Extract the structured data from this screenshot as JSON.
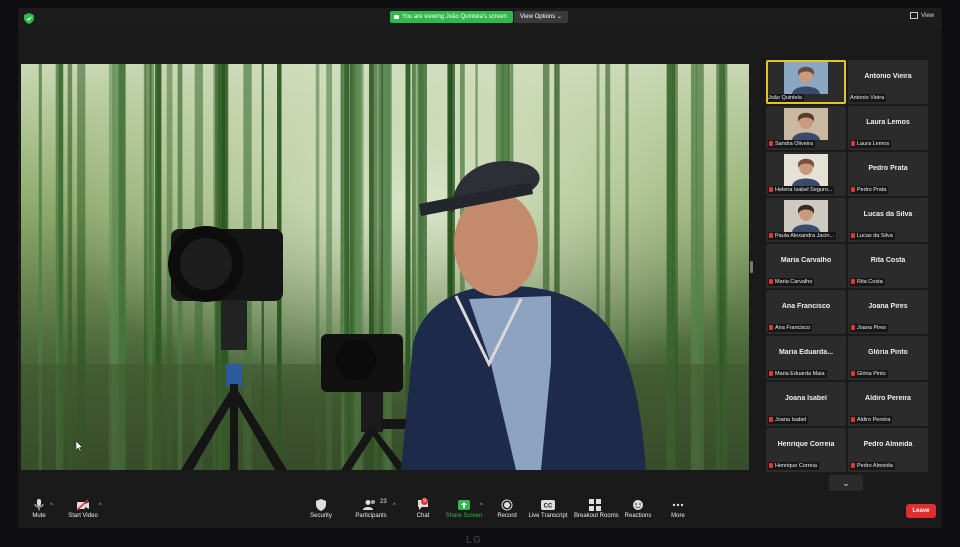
{
  "top_bar": {
    "viewing_banner": "You are viewing João Quintela's screen",
    "view_options_label": "View Options",
    "view_label": "View"
  },
  "gallery": {
    "tiles": [
      {
        "big_name": "",
        "label": "João Quintela",
        "has_video": true,
        "muted": false,
        "active": true
      },
      {
        "big_name": "Antonio Vieira",
        "label": "Antonio Vieira",
        "has_video": false,
        "muted": false
      },
      {
        "big_name": "",
        "label": "Sandra Oliveira",
        "has_video": true,
        "muted": true
      },
      {
        "big_name": "Laura Lemos",
        "label": "Laura Lemos",
        "has_video": false,
        "muted": true
      },
      {
        "big_name": "",
        "label": "Helena Isabel Seguro...",
        "has_video": true,
        "muted": true
      },
      {
        "big_name": "Pedro Prata",
        "label": "Pedro Prata",
        "has_video": false,
        "muted": true
      },
      {
        "big_name": "",
        "label": "Paula Alexandra Jacin...",
        "has_video": true,
        "muted": true
      },
      {
        "big_name": "Lucas da Silva",
        "label": "Lucas da Silva",
        "has_video": false,
        "muted": true
      },
      {
        "big_name": "Maria Carvalho",
        "label": "Maria Carvalho",
        "has_video": false,
        "muted": true
      },
      {
        "big_name": "Rita Costa",
        "label": "Rita Costa",
        "has_video": false,
        "muted": true
      },
      {
        "big_name": "Ana Francisco",
        "label": "Ana Francisco",
        "has_video": false,
        "muted": true
      },
      {
        "big_name": "Joana Pires",
        "label": "Joana Pires",
        "has_video": false,
        "muted": true
      },
      {
        "big_name": "Maria Eduarda...",
        "label": "Maria Eduarda Maia",
        "has_video": false,
        "muted": true
      },
      {
        "big_name": "Glória Pinto",
        "label": "Glória Pinto",
        "has_video": false,
        "muted": true
      },
      {
        "big_name": "Joana Isabel",
        "label": "Joana Isabel",
        "has_video": false,
        "muted": true
      },
      {
        "big_name": "Aldiro Pereira",
        "label": "Aldiro Pereira",
        "has_video": false,
        "muted": true
      },
      {
        "big_name": "Henrique Correia",
        "label": "Henrique Correia",
        "has_video": false,
        "muted": true
      },
      {
        "big_name": "Pedro Almeida",
        "label": "Pedro Almeida",
        "has_video": false,
        "muted": true
      }
    ],
    "next_page_icon": "chevron-down-icon"
  },
  "toolbar": {
    "mute": "Mute",
    "start_video": "Start Video",
    "security": "Security",
    "participants": "Participants",
    "participants_count": "23",
    "chat": "Chat",
    "chat_badge": "9",
    "share_screen": "Share Screen",
    "record": "Record",
    "live_transcript": "Live Transcript",
    "breakout_rooms": "Breakout Rooms",
    "reactions": "Reactions",
    "more": "More",
    "leave": "Leave"
  },
  "monitor_brand": "LG",
  "colors": {
    "share_green": "#2fb84b",
    "leave_red": "#e02d2d",
    "muted_red": "#e03535",
    "active_speaker": "#e3c52a"
  }
}
